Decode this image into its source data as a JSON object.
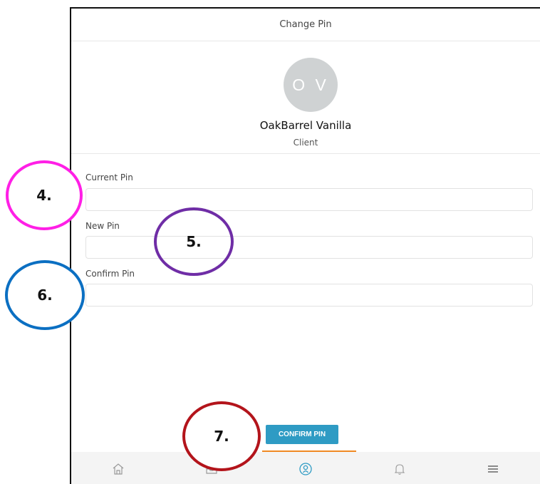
{
  "header": {
    "title": "Change Pin"
  },
  "profile": {
    "initials": "O V",
    "name": "OakBarrel Vanilla",
    "role": "Client"
  },
  "form": {
    "current_pin": {
      "label": "Current Pin",
      "value": ""
    },
    "new_pin": {
      "label": "New Pin",
      "value": ""
    },
    "confirm_pin": {
      "label": "Confirm Pin",
      "value": ""
    },
    "submit_label": "CONFIRM PIN"
  },
  "bottom_nav": {
    "items": [
      {
        "icon": "home-icon"
      },
      {
        "icon": "inbox-icon"
      },
      {
        "icon": "profile-icon",
        "active": true
      },
      {
        "icon": "bell-icon"
      },
      {
        "icon": "menu-icon"
      }
    ]
  },
  "annotations": [
    {
      "label": "4.",
      "color": "#ff1fe6"
    },
    {
      "label": "5.",
      "color": "#6f2da6"
    },
    {
      "label": "6.",
      "color": "#0b6fc2"
    },
    {
      "label": "7.",
      "color": "#b3141b"
    }
  ],
  "colors": {
    "accent": "#2e9bc4",
    "tab_indicator": "#f08a24",
    "avatar_bg": "#cfd2d3"
  }
}
